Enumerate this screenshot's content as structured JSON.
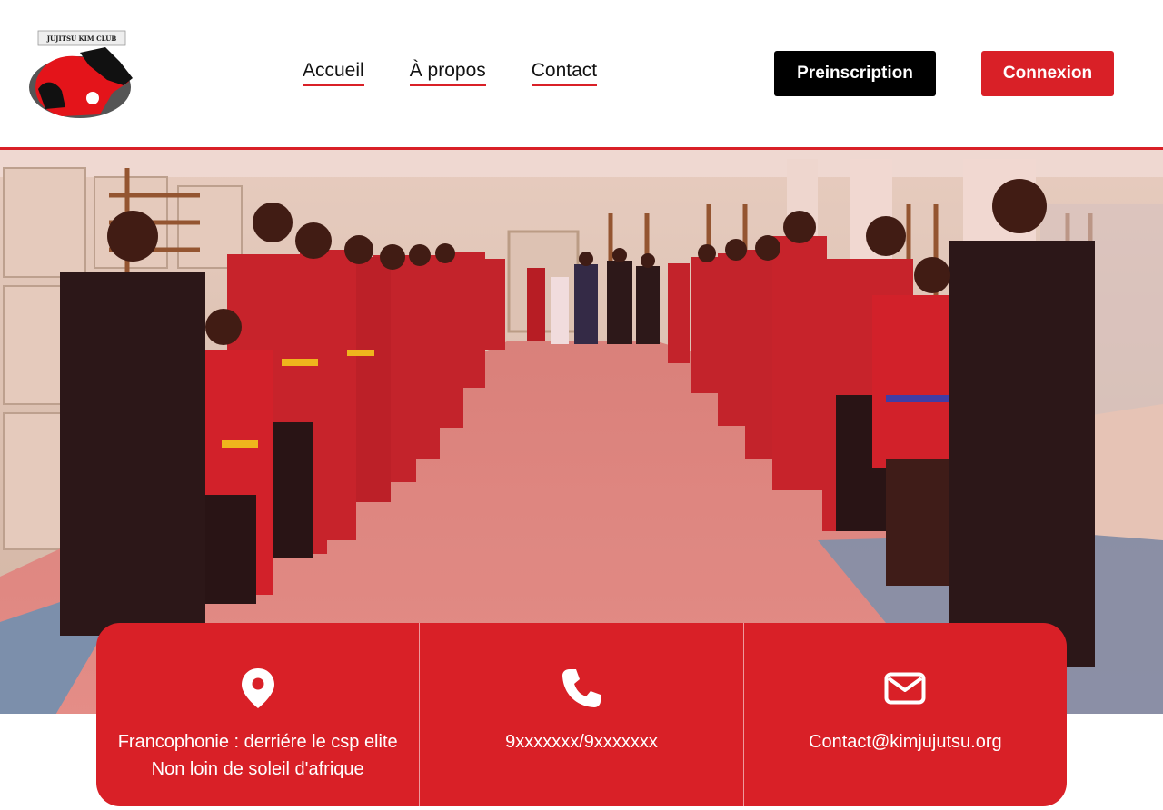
{
  "brand": {
    "logo_text": "JUJITSU KIM CLUB"
  },
  "nav": {
    "items": [
      {
        "label": "Accueil"
      },
      {
        "label": "À propos"
      },
      {
        "label": "Contact"
      }
    ]
  },
  "actions": {
    "preinscription": "Preinscription",
    "connexion": "Connexion"
  },
  "contact_cards": {
    "address_line1": "Francophonie : derriére le csp elite",
    "address_line2": "Non loin de soleil d'afrique",
    "phone": "9xxxxxxx/9xxxxxxx",
    "email": "Contact@kimjujutsu.org"
  },
  "colors": {
    "accent": "#d92027",
    "dark": "#000000"
  }
}
